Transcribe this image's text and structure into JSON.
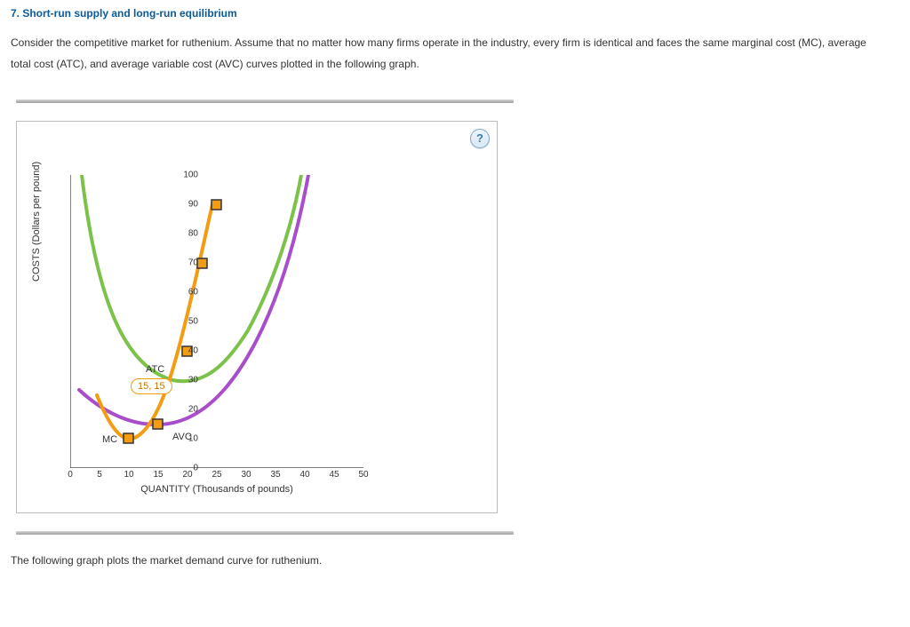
{
  "title": "7. Short-run supply and long-run equilibrium",
  "paragraph": "Consider the competitive market for ruthenium. Assume that no matter how many firms operate in the industry, every firm is identical and faces the same marginal cost (MC), average total cost (ATC), and average variable cost (AVC) curves plotted in the following graph.",
  "help": "?",
  "chart": {
    "ylabel": "COSTS (Dollars per pound)",
    "xlabel": "QUANTITY (Thousands of pounds)",
    "yticks": [
      "0",
      "10",
      "20",
      "30",
      "40",
      "50",
      "60",
      "70",
      "80",
      "90",
      "100"
    ],
    "xticks": [
      "0",
      "5",
      "10",
      "15",
      "20",
      "25",
      "30",
      "35",
      "40",
      "45",
      "50"
    ],
    "labels": {
      "mc": "MC",
      "atc": "ATC",
      "avc": "AVC"
    },
    "tooltip": "15, 15"
  },
  "chart_data": {
    "type": "line",
    "title": "",
    "xlabel": "QUANTITY (Thousands of pounds)",
    "ylabel": "COSTS (Dollars per pound)",
    "xlim": [
      0,
      50
    ],
    "ylim": [
      0,
      100
    ],
    "series": [
      {
        "name": "MC",
        "color": "#f39c12",
        "x": [
          5,
          10,
          15,
          20,
          22.5,
          25
        ],
        "y": [
          25,
          10,
          15,
          40,
          70,
          90
        ],
        "markers": [
          {
            "x": 10,
            "y": 10
          },
          {
            "x": 15,
            "y": 15
          },
          {
            "x": 20,
            "y": 40
          },
          {
            "x": 22.5,
            "y": 70
          },
          {
            "x": 25,
            "y": 90
          }
        ]
      },
      {
        "name": "ATC",
        "color": "#7cc24a",
        "x": [
          2,
          5,
          10,
          15,
          20,
          25,
          30,
          35,
          40
        ],
        "y": [
          100,
          65,
          40,
          30,
          30,
          38,
          55,
          80,
          100
        ]
      },
      {
        "name": "AVC",
        "color": "#a94ecb",
        "x": [
          2,
          5,
          10,
          15,
          20,
          25,
          30,
          35,
          40
        ],
        "y": [
          27,
          20,
          15,
          15,
          20,
          30,
          45,
          65,
          90
        ]
      }
    ],
    "annotation_point": {
      "x": 15,
      "y": 15,
      "label": "15, 15"
    }
  },
  "footer": "The following graph plots the market demand curve for ruthenium."
}
